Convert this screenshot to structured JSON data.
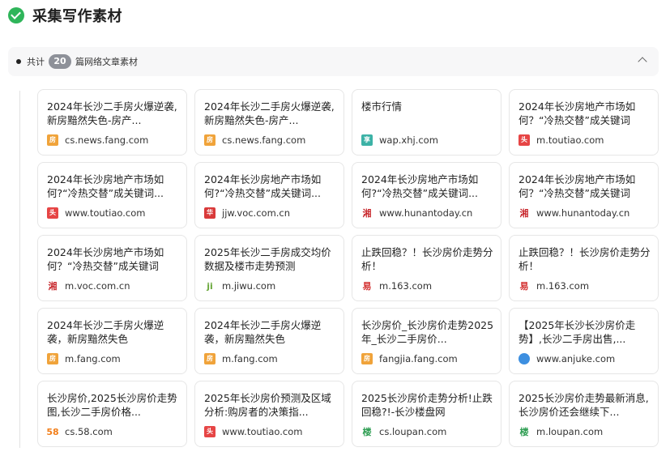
{
  "header": {
    "title": "采集写作素材"
  },
  "summary": {
    "prefix": "共计",
    "count": "20",
    "suffix": "篇网络文章素材"
  },
  "cards": [
    {
      "title": "2024年长沙二手房火爆逆袭,新房黯然失色-房产...",
      "domain": "cs.news.fang.com",
      "icon": "fang-icon",
      "icon_glyph": "房",
      "icon_color": "#f0a33a",
      "icon_text_color": "#ffffff"
    },
    {
      "title": "2024年长沙二手房火爆逆袭,新房黯然失色-房产...",
      "domain": "cs.news.fang.com",
      "icon": "fang-icon",
      "icon_glyph": "房",
      "icon_color": "#f0a33a",
      "icon_text_color": "#ffffff"
    },
    {
      "title": "楼市行情",
      "domain": "wap.xhj.com",
      "icon": "xhj-icon",
      "icon_glyph": "享",
      "icon_color": "#3cb2a6",
      "icon_text_color": "#ffffff"
    },
    {
      "title": "2024年长沙房地产市场如何？“冷热交替”成关键词",
      "domain": "m.toutiao.com",
      "icon": "toutiao-icon",
      "icon_glyph": "头",
      "icon_color": "#e64545",
      "icon_text_color": "#ffffff"
    },
    {
      "title": "2024年长沙房地产市场如何?“冷热交替”成关键词...",
      "domain": "www.toutiao.com",
      "icon": "toutiao-icon",
      "icon_glyph": "头",
      "icon_color": "#e64545",
      "icon_text_color": "#ffffff"
    },
    {
      "title": "2024年长沙房地产市场如何?“冷热交替”成关键词...",
      "domain": "jjw.voc.com.cn",
      "icon": "voc-icon",
      "icon_glyph": "华",
      "icon_color": "#d93a3a",
      "icon_text_color": "#ffffff"
    },
    {
      "title": "2024年长沙房地产市场如何?“冷热交替”成关键词...",
      "domain": "www.hunantoday.cn",
      "icon": "hunantoday-icon",
      "icon_glyph": "湘",
      "icon_color": "#ffffff",
      "icon_text_color": "#c8282d"
    },
    {
      "title": "2024年长沙房地产市场如何？“冷热交替”成关键词",
      "domain": "www.hunantoday.cn",
      "icon": "hunantoday-icon",
      "icon_glyph": "湘",
      "icon_color": "#ffffff",
      "icon_text_color": "#c8282d"
    },
    {
      "title": "2024年长沙房地产市场如何？“冷热交替”成关键词",
      "domain": "m.voc.com.cn",
      "icon": "voc-icon",
      "icon_glyph": "湘",
      "icon_color": "#ffffff",
      "icon_text_color": "#c8282d"
    },
    {
      "title": "2025年长沙二手房成交均价数据及楼市走势预测",
      "domain": "m.jiwu.com",
      "icon": "jiwu-icon",
      "icon_glyph": "ji",
      "icon_color": "#ffffff",
      "icon_text_color": "#6aa83c"
    },
    {
      "title": "止跌回稳？！长沙房价走势分析！",
      "domain": "m.163.com",
      "icon": "netease-icon",
      "icon_glyph": "易",
      "icon_color": "#ffffff",
      "icon_text_color": "#d22b2b"
    },
    {
      "title": "止跌回稳？！长沙房价走势分析！",
      "domain": "m.163.com",
      "icon": "netease-icon",
      "icon_glyph": "易",
      "icon_color": "#ffffff",
      "icon_text_color": "#d22b2b"
    },
    {
      "title": "2024年长沙二手房火爆逆袭，新房黯然失色",
      "domain": "m.fang.com",
      "icon": "fang-icon",
      "icon_glyph": "房",
      "icon_color": "#f0a33a",
      "icon_text_color": "#ffffff"
    },
    {
      "title": "2024年长沙二手房火爆逆袭，新房黯然失色",
      "domain": "m.fang.com",
      "icon": "fang-icon",
      "icon_glyph": "房",
      "icon_color": "#f0a33a",
      "icon_text_color": "#ffffff"
    },
    {
      "title": "长沙房价_长沙房价走势2025年_长沙二手房价...",
      "domain": "fangjia.fang.com",
      "icon": "fang-icon",
      "icon_glyph": "房",
      "icon_color": "#f0a33a",
      "icon_text_color": "#ffffff"
    },
    {
      "title": "【2025年长沙长沙房价走势】,长沙二手房出售,...",
      "domain": "www.anjuke.com",
      "icon": "globe-icon",
      "icon_glyph": "",
      "icon_color": "#3d8fe0",
      "icon_text_color": "#ffffff"
    },
    {
      "title": "长沙房价,2025长沙房价走势图,长沙二手房价格...",
      "domain": "cs.58.com",
      "icon": "58-icon",
      "icon_glyph": "58",
      "icon_color": "#ffffff",
      "icon_text_color": "#f27f1b"
    },
    {
      "title": "2025年长沙房价预测及区域分析:购房者的决策指...",
      "domain": "www.toutiao.com",
      "icon": "toutiao-icon",
      "icon_glyph": "头",
      "icon_color": "#e64545",
      "icon_text_color": "#ffffff"
    },
    {
      "title": "2025长沙房价走势分析!止跌回稳?!-长沙楼盘网",
      "domain": "cs.loupan.com",
      "icon": "loupan-icon",
      "icon_glyph": "楼",
      "icon_color": "#ffffff",
      "icon_text_color": "#2f9e53"
    },
    {
      "title": "2025长沙房价走势最新消息,长沙房价还会继续下...",
      "domain": "m.loupan.com",
      "icon": "loupan-icon",
      "icon_glyph": "楼",
      "icon_color": "#ffffff",
      "icon_text_color": "#2f9e53"
    }
  ]
}
